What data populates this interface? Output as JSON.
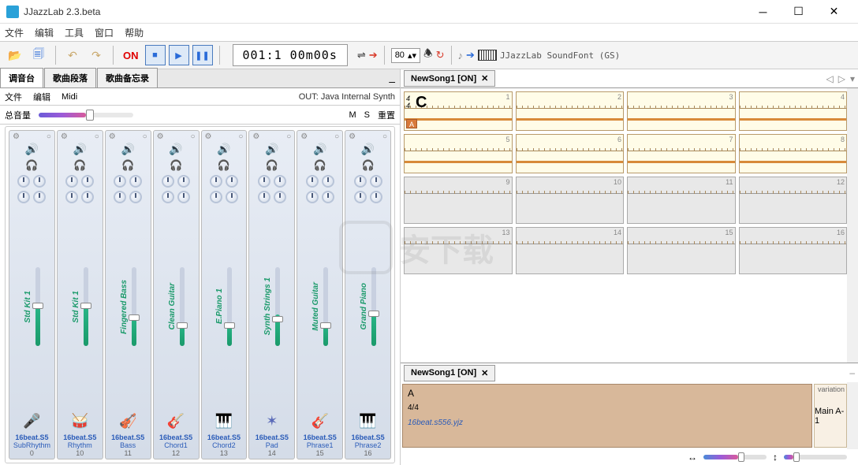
{
  "title": "JJazzLab  2.3.beta",
  "menu": [
    "文件",
    "编辑",
    "工具",
    "窗口",
    "帮助"
  ],
  "toolbar": {
    "on": "ON",
    "time": "001:1  00m00s",
    "tempo": "80",
    "soundfont": "JJazzLab SoundFont (GS)"
  },
  "left": {
    "tabs": [
      "调音台",
      "歌曲段落",
      "歌曲备忘录"
    ],
    "sub_menu": [
      "文件",
      "编辑",
      "Midi"
    ],
    "out": "OUT: Java Internal Synth",
    "master_label": "总音量",
    "m": "M",
    "s": "S",
    "reset": "重置",
    "channels": [
      {
        "name": "Std Kit 1",
        "preset": "16beat.S5",
        "label": "SubRhythm",
        "num": "0",
        "icon": "🎤"
      },
      {
        "name": "Std Kit 1",
        "preset": "16beat.S5",
        "label": "Rhythm",
        "num": "10",
        "icon": "🥁"
      },
      {
        "name": "Fingered Bass",
        "preset": "16beat.S5",
        "label": "Bass",
        "num": "11",
        "icon": "🎻"
      },
      {
        "name": "Clean Guitar",
        "preset": "16beat.S5",
        "label": "Chord1",
        "num": "12",
        "icon": "🎸"
      },
      {
        "name": "E.Piano 1",
        "preset": "16beat.S5",
        "label": "Chord2",
        "num": "13",
        "icon": "🎹"
      },
      {
        "name": "Synth Strings 1",
        "preset": "16beat.S5",
        "label": "Pad",
        "num": "14",
        "icon": "✶"
      },
      {
        "name": "Muted Guitar",
        "preset": "16beat.S5",
        "label": "Phrase1",
        "num": "15",
        "icon": "🎸"
      },
      {
        "name": "Grand Piano",
        "preset": "16beat.S5",
        "label": "Phrase2",
        "num": "16",
        "icon": "🎹"
      }
    ]
  },
  "right": {
    "song_tab": "NewSong1  [ON]",
    "chord": "C",
    "timesig_top": "4",
    "timesig_bot": "4",
    "marker": "A",
    "bars_yellow": [
      1,
      2,
      3,
      4,
      5,
      6,
      7,
      8
    ],
    "bars_gray": [
      9,
      10,
      11,
      12,
      13,
      14,
      15,
      16
    ]
  },
  "bottom": {
    "tab": "NewSong1  [ON]",
    "section_letter": "A",
    "section_ts": "4/4",
    "rhythm_file": "16beat.s556.yjz",
    "variation": "variation",
    "main_label": "Main A-1"
  },
  "watermark": "安下载"
}
